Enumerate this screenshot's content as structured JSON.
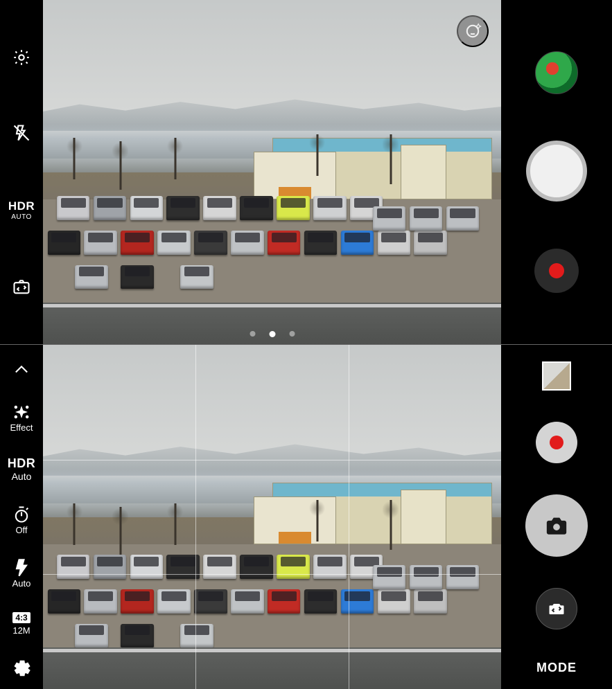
{
  "top": {
    "left": {
      "settings_icon": "settings",
      "flash_off_icon": "flash-off",
      "hdr_label": "HDR",
      "hdr_sub": "AUTO",
      "switch_camera_icon": "switch-camera"
    },
    "right": {
      "gallery_thumb_desc": "last-photo-thumbnail",
      "shutter_icon": "shutter",
      "record_icon": "record"
    },
    "overlay": {
      "beauty_icon": "face-retouch",
      "pager_active_index": 1,
      "pager_count": 3
    }
  },
  "bottom": {
    "left": {
      "collapse_icon": "chevron-up",
      "effect_icon": "sparkle",
      "effect_label": "Effect",
      "hdr_label": "HDR",
      "hdr_sub": "Auto",
      "timer_icon": "timer",
      "timer_label": "Off",
      "flash_icon": "flash",
      "flash_label": "Auto",
      "ratio_badge": "4:3",
      "resolution_label": "12M",
      "settings_icon": "settings"
    },
    "right": {
      "gallery_thumb_desc": "last-photo-thumbnail",
      "record_icon": "record",
      "shutter_icon": "camera",
      "switch_camera_icon": "switch-camera",
      "mode_label": "MODE"
    },
    "overlay": {
      "grid": "rule-of-thirds"
    }
  },
  "colors": {
    "record_red": "#e21b1b",
    "shutter_fill_top": "#f2f2f2",
    "shutter_ring": "#b9b9b9",
    "overlay_btn_bg": "rgba(130,130,130,0.75)"
  }
}
